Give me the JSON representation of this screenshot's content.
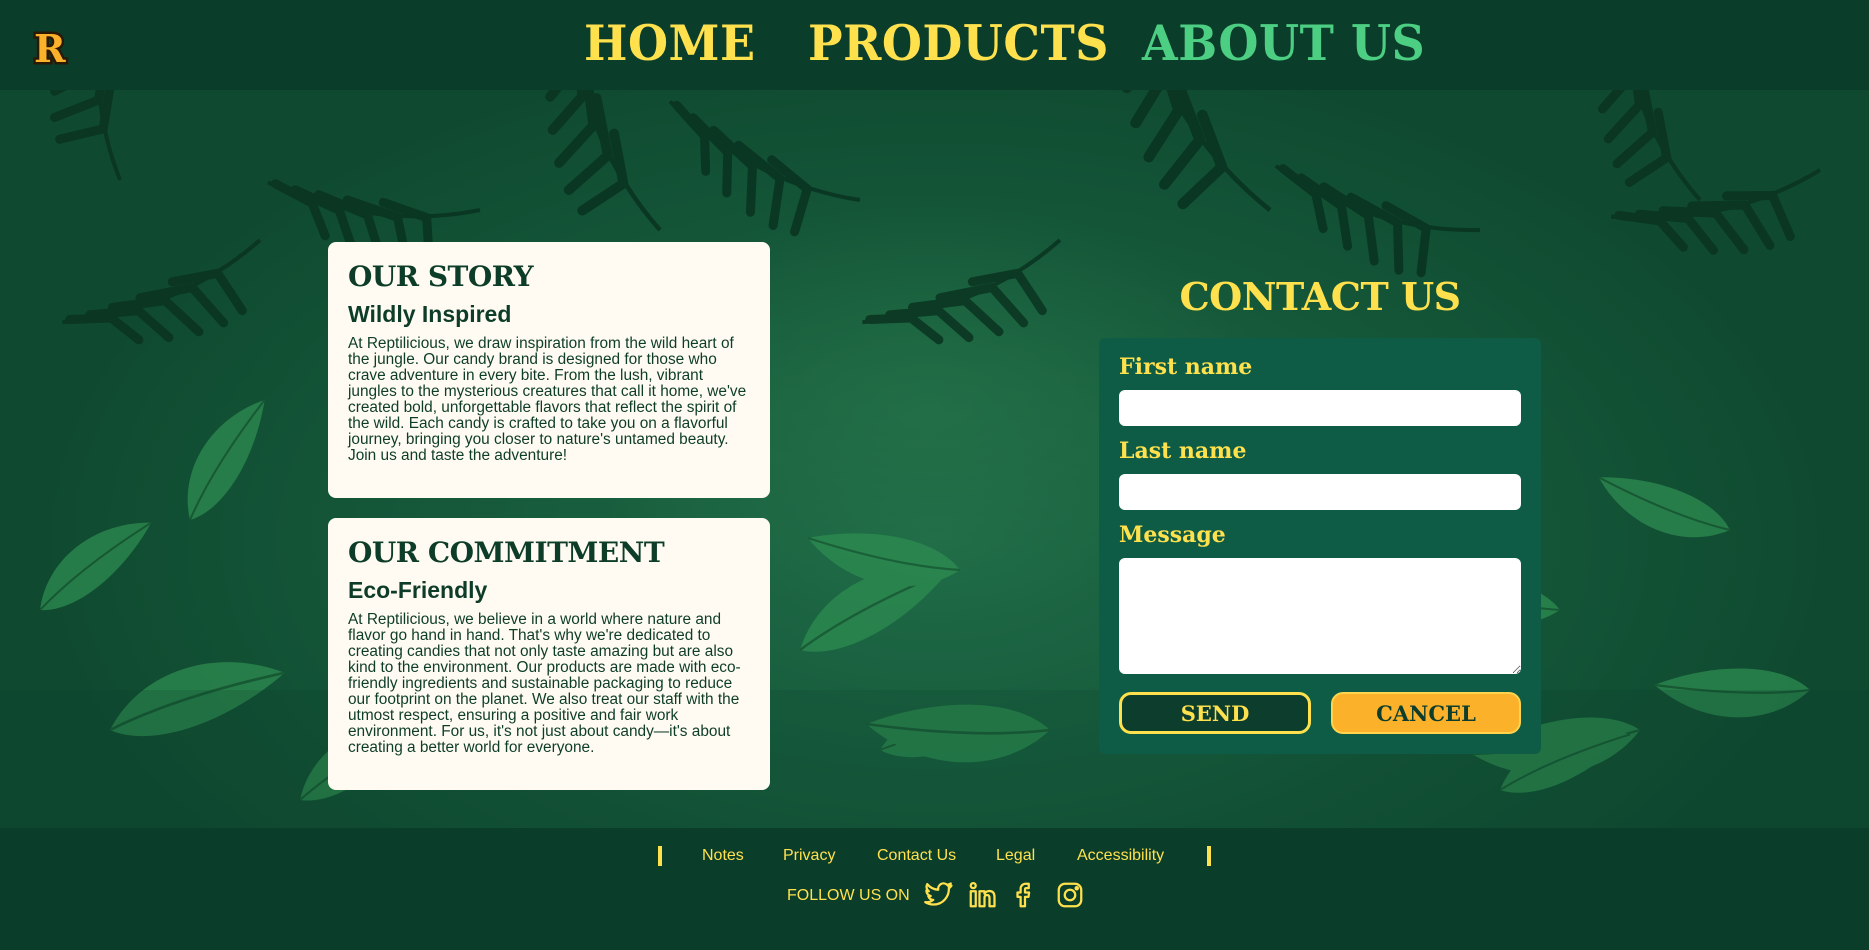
{
  "nav": {
    "logo_letter": "R",
    "links": [
      {
        "label": "HOME"
      },
      {
        "label": "PRODUCTS"
      },
      {
        "label": "ABOUT US"
      }
    ],
    "active": "ABOUT US"
  },
  "story": {
    "title": "OUR STORY",
    "subtitle": "Wildly Inspired",
    "body": "At Reptilicious, we draw inspiration from the wild heart of the jungle. Our candy brand is designed for those who crave adventure in every bite. From the lush, vibrant jungles to the mysterious creatures that call it home, we've created bold, unforgettable flavors that reflect the spirit of the wild. Each candy is crafted to take you on a flavorful journey, bringing you closer to nature's untamed beauty. Join us and taste the adventure!"
  },
  "commitment": {
    "title": "OUR COMMITMENT",
    "subtitle": "Eco-Friendly",
    "body": "At Reptilicious, we believe in a world where nature and flavor go hand in hand. That's why we're dedicated to creating candies that not only taste amazing but are also kind to the environment. Our products are made with eco-friendly ingredients and sustainable packaging to reduce our footprint on the planet. We also treat our staff with the utmost respect, ensuring a positive and fair work environment. For us, it's not just about candy—it's about creating a better world for everyone."
  },
  "contact": {
    "title": "CONTACT US",
    "first_name_label": "First name",
    "first_name_value": "",
    "last_name_label": "Last name",
    "last_name_value": "",
    "message_label": "Message",
    "message_value": "",
    "send_label": "SEND",
    "cancel_label": "CANCEL"
  },
  "footer": {
    "links": [
      "Notes",
      "Privacy",
      "Contact Us",
      "Legal",
      "Accessibility"
    ],
    "follow_label": "FOLLOW US ON",
    "social_icons": [
      "twitter-icon",
      "linkedin-icon",
      "facebook-icon",
      "instagram-icon"
    ]
  },
  "colors": {
    "dark_green": "#0b3d2b",
    "accent_yellow": "#ffe14d",
    "active_green": "#4ccf82",
    "card_bg": "#fffbf2",
    "form_bg": "#0e5c45",
    "cancel_orange": "#fbb22a"
  }
}
